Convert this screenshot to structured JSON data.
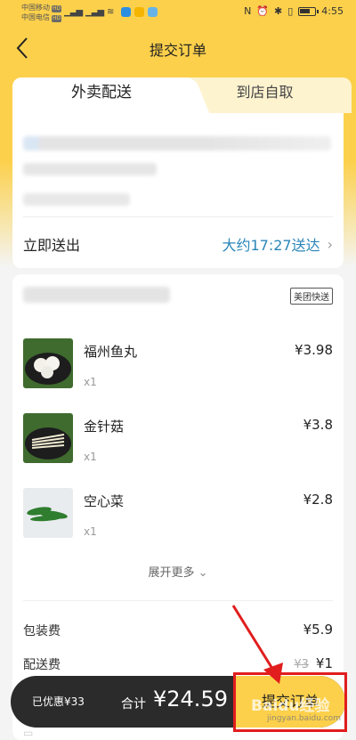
{
  "status_bar": {
    "carrier1": "中国移动",
    "carrier2": "中国电信",
    "hd": "HD",
    "time": "4:55"
  },
  "nav": {
    "title": "提交订单"
  },
  "tabs": {
    "delivery": "外卖配送",
    "pickup": "到店自取"
  },
  "delivery": {
    "send_now": "立即送出",
    "eta": "大约17:27送达"
  },
  "shop": {
    "badge": "美团快送"
  },
  "items": [
    {
      "name": "福州鱼丸",
      "qty": "x1",
      "price": "¥3.98"
    },
    {
      "name": "金针菇",
      "qty": "x1",
      "price": "¥3.8"
    },
    {
      "name": "空心菜",
      "qty": "x1",
      "price": "¥2.8"
    }
  ],
  "show_more": "展开更多",
  "fees": {
    "packing_label": "包装费",
    "packing": "¥5.9",
    "delivery_label": "配送费",
    "delivery_original": "¥3",
    "delivery": "¥1"
  },
  "bottom": {
    "discount": "已优惠¥33",
    "total_label": "合计",
    "total": "¥24.59",
    "submit": "提交订单"
  },
  "watermark": {
    "main": "Baidu经验",
    "sub": "jingyan.baidu.com"
  },
  "colors": {
    "brand_yellow": "#fcd04b",
    "eta_blue": "#2a86b8",
    "highlight_red": "#e11d1d"
  }
}
